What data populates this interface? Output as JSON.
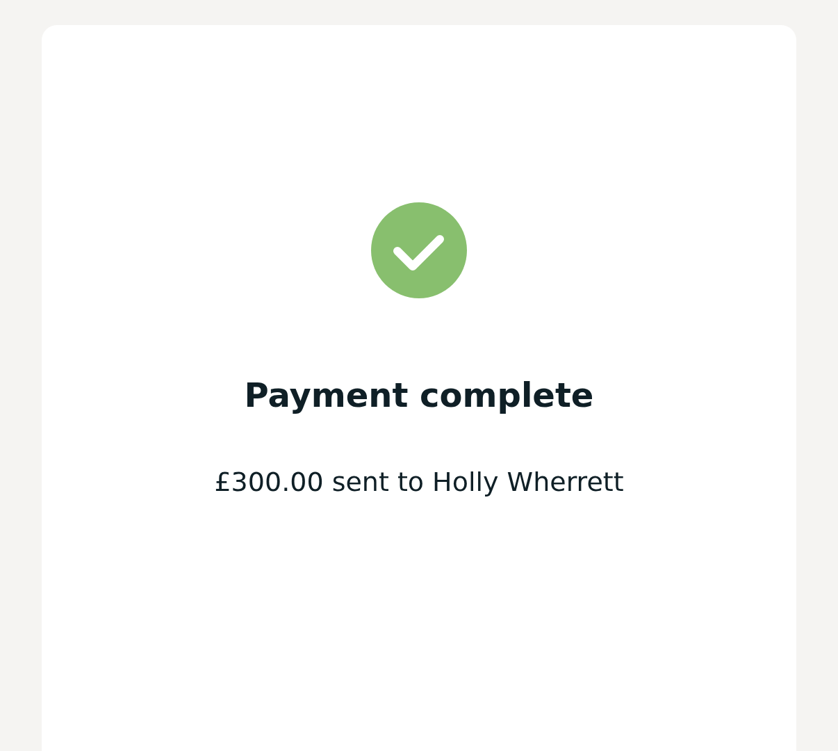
{
  "status": {
    "kind": "success",
    "title": "Payment complete",
    "message": "£300.00 sent to Holly Wherrett"
  }
}
